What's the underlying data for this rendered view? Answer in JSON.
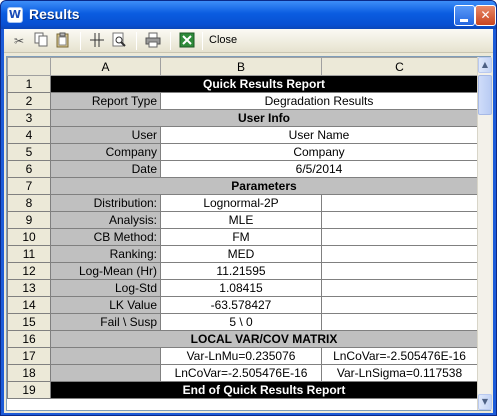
{
  "window": {
    "title": "Results",
    "app_icon_letter": "W",
    "icons": {
      "minimize": "minimize-icon",
      "close": "close-icon",
      "app": "weibull-app-icon"
    }
  },
  "toolbar": {
    "close_label": "Close",
    "tools": [
      "cut-icon",
      "copy-icon",
      "paste-icon",
      "column-fit-icon",
      "print-preview-icon",
      "print-icon",
      "excel-export-icon"
    ]
  },
  "sheet": {
    "columns": [
      "A",
      "B",
      "C"
    ],
    "rows": [
      {
        "n": "1",
        "type": "black",
        "text": "Quick Results Report"
      },
      {
        "n": "2",
        "type": "kv",
        "label": "Report Type",
        "value": "Degradation Results"
      },
      {
        "n": "3",
        "type": "gray",
        "text": "User Info"
      },
      {
        "n": "4",
        "type": "kv",
        "label": "User",
        "value": "User Name"
      },
      {
        "n": "5",
        "type": "kv",
        "label": "Company",
        "value": "Company"
      },
      {
        "n": "6",
        "type": "kv",
        "label": "Date",
        "value": "6/5/2014"
      },
      {
        "n": "7",
        "type": "gray",
        "text": "Parameters"
      },
      {
        "n": "8",
        "type": "kv3",
        "label": "Distribution:",
        "b": "Lognormal-2P",
        "c": ""
      },
      {
        "n": "9",
        "type": "kv3",
        "label": "Analysis:",
        "b": "MLE",
        "c": ""
      },
      {
        "n": "10",
        "type": "kv3",
        "label": "CB Method:",
        "b": "FM",
        "c": ""
      },
      {
        "n": "11",
        "type": "kv3",
        "label": "Ranking:",
        "b": "MED",
        "c": ""
      },
      {
        "n": "12",
        "type": "kv3",
        "label": "Log-Mean (Hr)",
        "b": "11.21595",
        "c": ""
      },
      {
        "n": "13",
        "type": "kv3",
        "label": "Log-Std",
        "b": "1.08415",
        "c": ""
      },
      {
        "n": "14",
        "type": "kv3",
        "label": "LK Value",
        "b": "-63.578427",
        "c": ""
      },
      {
        "n": "15",
        "type": "kv3",
        "label": "Fail \\ Susp",
        "b": "5 \\ 0",
        "c": ""
      },
      {
        "n": "16",
        "type": "gray",
        "text": "LOCAL VAR/COV MATRIX"
      },
      {
        "n": "17",
        "type": "kv3",
        "label": "",
        "b": "Var-LnMu=0.235076",
        "c": "LnCoVar=-2.505476E-16"
      },
      {
        "n": "18",
        "type": "kv3",
        "label": "",
        "b": "LnCoVar=-2.505476E-16",
        "c": "Var-LnSigma=0.117538"
      },
      {
        "n": "19",
        "type": "black",
        "text": "End of Quick Results Report"
      }
    ]
  },
  "scrollbar": {
    "up_icon": "scroll-up-arrow-icon",
    "down_icon": "scroll-down-arrow-icon"
  }
}
